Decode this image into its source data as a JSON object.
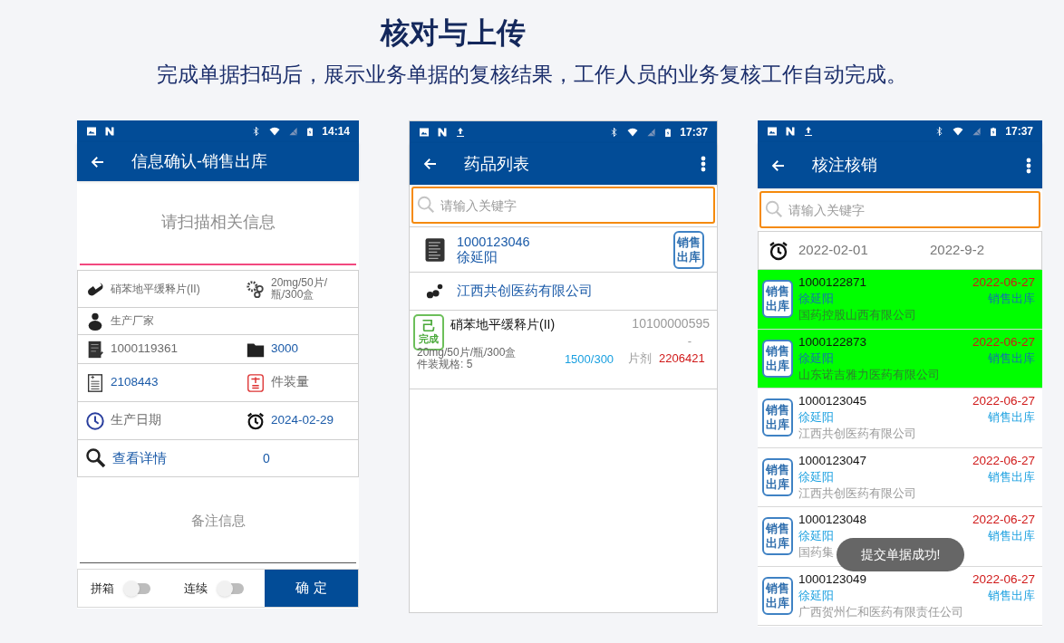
{
  "heading": {
    "title": "核对与上传",
    "subtitle": "完成单据扫码后，展示业务单据的复核结果，工作人员的业务复核工作自动完成。"
  },
  "confirm_screen": {
    "status_bar": {
      "time": "14:14",
      "upload_icon": false
    },
    "title": "信息确认-销售出库",
    "scan_field": {
      "placeholder": "请扫描相关信息"
    },
    "info_rows": [
      [
        {
          "text": "硝苯地平缓释片(II)",
          "kind": "hint"
        },
        {
          "text": "20mg/50片/瓶/300盒",
          "kind": "hint"
        }
      ],
      [
        {
          "text": "生产厂家",
          "kind": "hint"
        }
      ],
      [
        {
          "text": "1000119361",
          "kind": "hint"
        },
        {
          "text": "3000",
          "kind": "value"
        }
      ],
      [
        {
          "text": "2108443",
          "kind": "value"
        },
        {
          "text": "件装量",
          "kind": "hint"
        }
      ],
      [
        {
          "text": "生产日期",
          "kind": "hint"
        },
        {
          "text": "2024-02-29",
          "kind": "value"
        }
      ]
    ],
    "detail_link": "查看详情",
    "detail_count": "0",
    "remark_field": {
      "placeholder": "备注信息"
    },
    "switches": [
      {
        "label": "拼箱",
        "on": false
      },
      {
        "label": "连续",
        "on": false
      }
    ],
    "confirm_button": "确 定"
  },
  "drug_list_screen": {
    "status_bar": {
      "time": "17:37",
      "upload_icon": true
    },
    "title": "药品列表",
    "search": {
      "placeholder": "请输入关键字"
    },
    "order": {
      "number": "1000123046",
      "person": "徐延阳",
      "badge": "销售出库"
    },
    "company": "江西共创医药有限公司",
    "items": [
      {
        "status_top": "己",
        "status_bottom": "完成",
        "name": "硝苯地平缓释片(II)",
        "code": "10100000595",
        "code_suffix": "-",
        "spec": "20mg/50片/瓶/300盒",
        "package": "件装规格: 5",
        "quantity": "1500/300",
        "form": "片剂",
        "batch": "2206421"
      }
    ]
  },
  "verify_screen": {
    "status_bar": {
      "time": "17:37",
      "upload_icon": true
    },
    "title": "核注核销",
    "search": {
      "placeholder": "请输入关键字"
    },
    "date_range": {
      "start": "2022-02-01",
      "end": "2022-9-2"
    },
    "orders": [
      {
        "badge": "销售出库",
        "number": "1000122871",
        "date": "2022-06-27",
        "person": "徐延阳",
        "type": "销售出库",
        "company": "国药控股山西有限公司",
        "done": true
      },
      {
        "badge": "销售出库",
        "number": "1000122873",
        "date": "2022-06-27",
        "person": "徐延阳",
        "type": "销售出库",
        "company": "山东诺吉雅力医药有限公司",
        "done": true
      },
      {
        "badge": "销售出库",
        "number": "1000123045",
        "date": "2022-06-27",
        "person": "徐延阳",
        "type": "销售出库",
        "company": "江西共创医药有限公司",
        "done": false
      },
      {
        "badge": "销售出库",
        "number": "1000123047",
        "date": "2022-06-27",
        "person": "徐延阳",
        "type": "销售出库",
        "company": "江西共创医药有限公司",
        "done": false
      },
      {
        "badge": "销售出库",
        "number": "1000123048",
        "date": "2022-06-27",
        "person": "徐延阳",
        "type": "销售出库",
        "company": "国药集",
        "done": false
      },
      {
        "badge": "销售出库",
        "number": "1000123049",
        "date": "2022-06-27",
        "person": "徐延阳",
        "type": "销售出库",
        "company": "广西贺州仁和医药有限责任公司",
        "done": false
      }
    ],
    "toast": "提交单据成功!"
  }
}
